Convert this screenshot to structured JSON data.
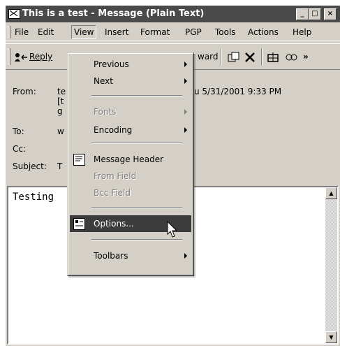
{
  "window": {
    "title": "This is a test - Message (Plain Text)",
    "controls": {
      "minimize": "_",
      "maximize": "□",
      "close": "×"
    }
  },
  "menubar": {
    "items": [
      "File",
      "Edit",
      "View",
      "Insert",
      "Format",
      "PGP",
      "Tools",
      "Actions",
      "Help"
    ]
  },
  "toolbar": {
    "reply_label": "Reply",
    "forward_label": "ward"
  },
  "headers": {
    "from_label": "From:",
    "from_value_1": "te",
    "from_value_2": "[t",
    "from_value_3": "g",
    "sent_value": "u 5/31/2001 9:33 PM",
    "to_label": "To:",
    "to_value": "w",
    "cc_label": "Cc:",
    "subject_label": "Subject:",
    "subject_value": "T"
  },
  "message": {
    "body_text": "Testing"
  },
  "view_menu": {
    "items": [
      {
        "label": "Previous",
        "enabled": true,
        "submenu": true
      },
      {
        "label": "Next",
        "enabled": true,
        "submenu": true
      },
      {
        "label": "Fonts",
        "enabled": false,
        "submenu": true
      },
      {
        "label": "Encoding",
        "enabled": true,
        "submenu": true
      },
      {
        "label": "Message Header",
        "enabled": true,
        "submenu": false,
        "icon": "message-header-icon"
      },
      {
        "label": "From Field",
        "enabled": false,
        "submenu": false
      },
      {
        "label": "Bcc Field",
        "enabled": false,
        "submenu": false
      },
      {
        "label": "Options...",
        "enabled": true,
        "submenu": false,
        "icon": "options-icon",
        "selected": true
      },
      {
        "label": "Toolbars",
        "enabled": true,
        "submenu": true
      }
    ]
  },
  "colors": {
    "face": "#d4d0c8",
    "titlebar": "#4a4a4a",
    "selection": "#3c3c3c"
  }
}
